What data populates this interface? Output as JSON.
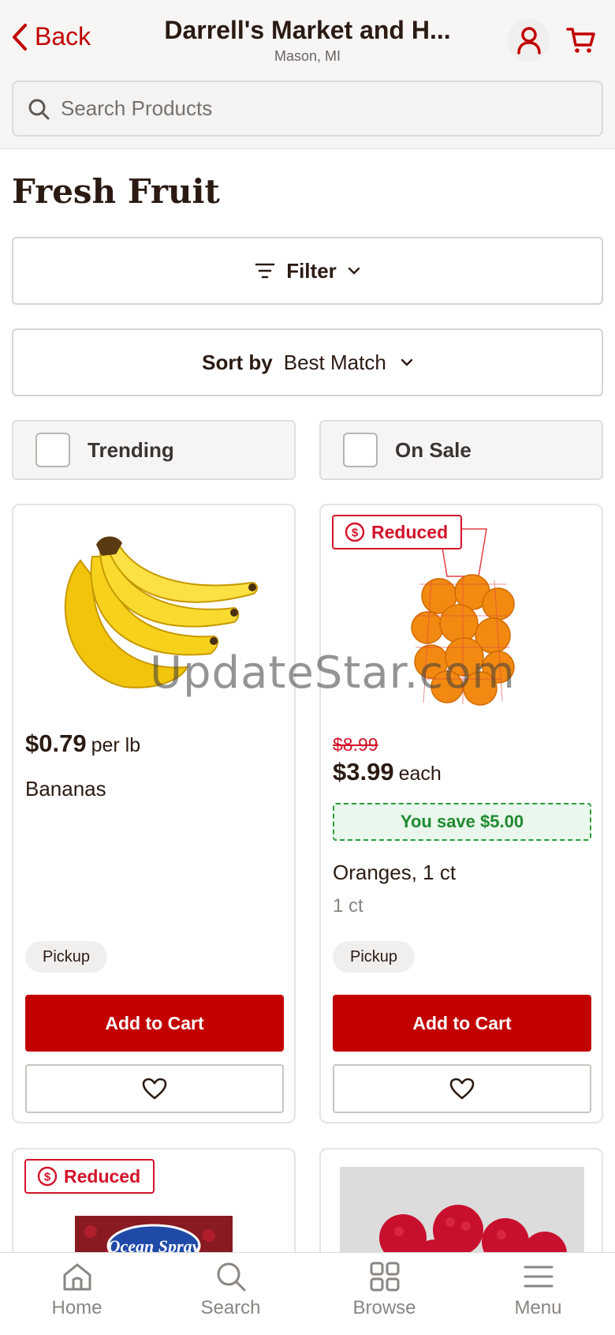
{
  "header": {
    "back_label": "Back",
    "store_name": "Darrell's Market and H...",
    "store_location": "Mason, MI"
  },
  "search": {
    "placeholder": "Search Products"
  },
  "page_title": "Fresh Fruit",
  "filter": {
    "label": "Filter"
  },
  "sort": {
    "label": "Sort by",
    "value": "Best Match"
  },
  "toggles": {
    "trending": "Trending",
    "on_sale": "On Sale"
  },
  "products": [
    {
      "name": "Bananas",
      "price": "$0.79",
      "unit": "per lb",
      "fulfillment": "Pickup",
      "add_label": "Add to Cart"
    },
    {
      "badge": "Reduced",
      "name": "Oranges, 1 ct",
      "size": "1 ct",
      "old_price": "$8.99",
      "price": "$3.99",
      "unit": "each",
      "savings": "You save $5.00",
      "fulfillment": "Pickup",
      "add_label": "Add to Cart"
    },
    {
      "badge": "Reduced",
      "brand_logo": "Ocean Spray"
    },
    {}
  ],
  "watermark": "UpdateStar.com",
  "nav": {
    "home": "Home",
    "search": "Search",
    "browse": "Browse",
    "menu": "Menu"
  },
  "colors": {
    "brand_red": "#c30000",
    "sale_red": "#d3122a",
    "savings_green": "#1f8a30"
  }
}
